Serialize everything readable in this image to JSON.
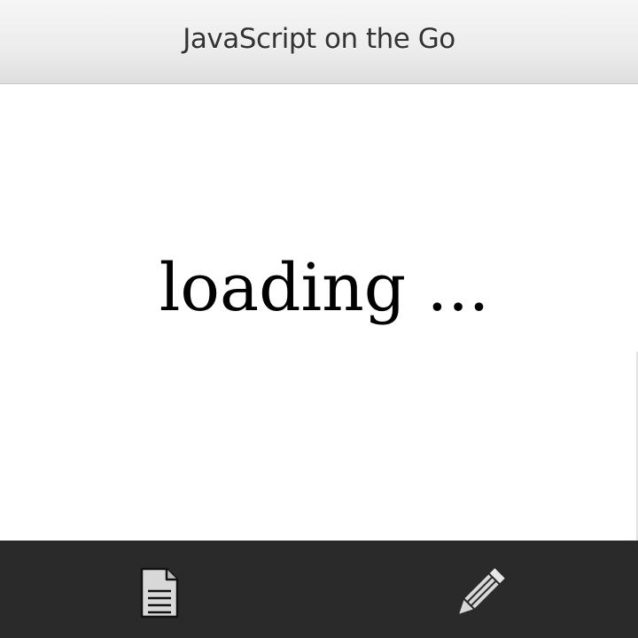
{
  "title_bar": {
    "title": "JavaScript on the Go"
  },
  "content": {
    "status_text": "loading ..."
  },
  "action_bar": {
    "left_action": {
      "icon": "document-icon"
    },
    "right_action": {
      "icon": "pencil-icon"
    }
  },
  "colors": {
    "title_bar_bg": "#ececec",
    "title_text": "#333333",
    "content_bg": "#ffffff",
    "action_bar_bg": "#2a2a2a",
    "icon_fill": "#d8d8d8"
  }
}
